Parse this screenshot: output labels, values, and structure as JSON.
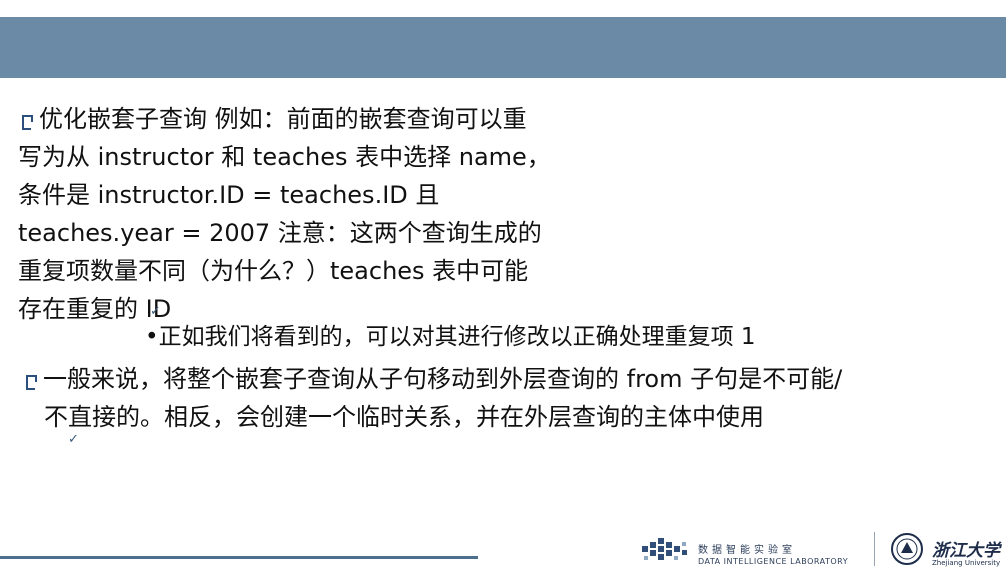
{
  "colors": {
    "header_bar": "#6a8aa6",
    "bullet": "#2a4f7c",
    "footer_line": "#4b6f8c"
  },
  "slide": {
    "paragraph1": {
      "lines": [
        "优化嵌套子查询 例如：前面的嵌套查询可以重",
        "写为从 instructor 和 teaches 表中选择 name，",
        "条件是 instructor.ID = teaches.ID 且",
        "teaches.year = 2007 注意：这两个查询生成的",
        "重复项数量不同（为什么？）teaches 表中可能",
        "存在重复的 ID"
      ]
    },
    "sub_bullet": "•正如我们将看到的，可以对其进行修改以正确处理重复项 1",
    "paragraph2": {
      "lines": [
        "一般来说，将整个嵌套子查询从子句移动到外层查询的 from 子句是不可能/",
        "不直接的。相反，会创建一个临时关系，并在外层查询的主体中使用"
      ]
    },
    "check_mark": "✓"
  },
  "footer": {
    "lab_name_cn": "数据智能实验室",
    "lab_name_en": "DATA INTELLIGENCE LABORATORY",
    "university_cn": "浙江大学",
    "university_en": "Zhejiang University"
  },
  "icons": [
    "bullet-square-icon",
    "check-icon",
    "lab-logo-icon",
    "university-seal-icon"
  ]
}
